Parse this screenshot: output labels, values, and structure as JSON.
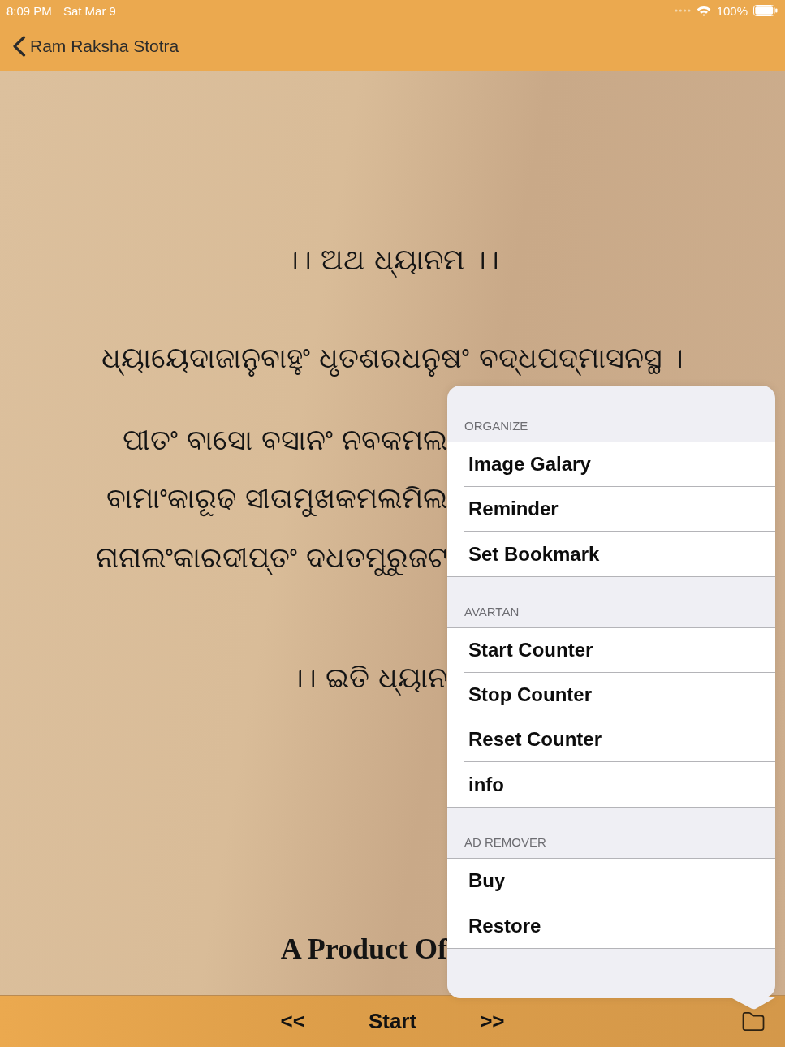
{
  "status_bar": {
    "time": "8:09 PM",
    "date": "Sat Mar 9",
    "battery": "100%"
  },
  "nav_bar": {
    "back_label": "Ram Raksha Stotra"
  },
  "content": {
    "heading": "।। ଅଥ ଧ୍ୟାନମ ।।",
    "verse_lines": [
      "ଧ୍ୟାୟେଦାଜାନୁବାହୁଂ ଧୃତଶରଧନୁଷଂ ବଦ୍ଧପଦ୍ମାସନସ୍ଥ ।",
      "ପୀତଂ ବାସୋ ବସାନଂ ନବକମଲ",
      "ବାମାଂକାରୂଢ ସୀତାମୁଖକମଲମିଲ",
      "ନାନାଲଂକାରଦୀପ୍ତଂ ଦଧତମୁରୁଜଟ"
    ],
    "closing": "।। ଇତି ଧ୍ୟାନ",
    "credit": "A Product Of"
  },
  "menu": {
    "sections": [
      {
        "header": "ORGANIZE",
        "items": [
          "Image Galary",
          "Reminder",
          "Set Bookmark"
        ]
      },
      {
        "header": "AVARTAN",
        "items": [
          "Start Counter",
          "Stop Counter",
          "Reset Counter",
          "info"
        ]
      },
      {
        "header": "AD REMOVER",
        "items": [
          "Buy",
          "Restore"
        ]
      }
    ]
  },
  "toolbar": {
    "buttons": [
      "<<",
      "Start",
      ">>"
    ]
  }
}
